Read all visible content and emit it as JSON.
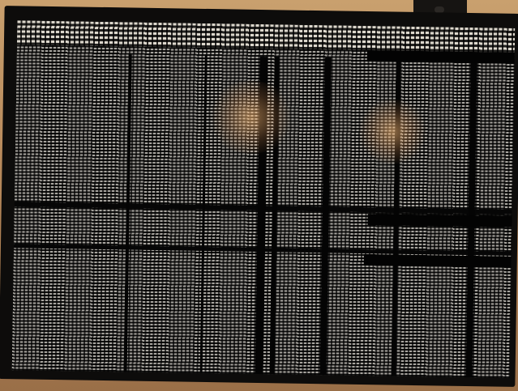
{
  "scene": {
    "kind": "photo of a monitor displaying dense terminal text",
    "wall_color": "#b88a5c",
    "bezel_color": "#0d0c0b",
    "screen_color": "#050505",
    "text_color": "#e2ded6",
    "glare_color": "#ffbe78",
    "icons": [
      "webcam-icon"
    ]
  },
  "terminal": {
    "legible_text": ""
  }
}
